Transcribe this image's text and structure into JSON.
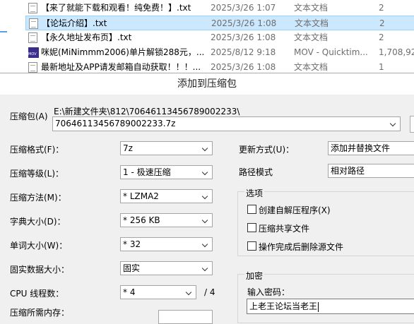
{
  "files": [
    {
      "name": "【来了就能下载和观看！纯免费！】.txt",
      "date": "2025/3/26 1:07",
      "type": "文本文档",
      "size": "2",
      "icon": "txt-file-icon",
      "selected": false
    },
    {
      "name": "【论坛介绍】.txt",
      "date": "2025/3/26 1:08",
      "type": "文本文档",
      "size": "2",
      "icon": "txt-file-icon",
      "selected": true
    },
    {
      "name": "【永久地址发布页】.txt",
      "date": "2025/3/26 1:08",
      "type": "文本文档",
      "size": "2",
      "icon": "txt-file-icon",
      "selected": false
    },
    {
      "name": "咪妮(MiNimmm2006)单片解锁288元，...",
      "date": "2025/8/12 9:18",
      "type": "MOV - Quicktim...",
      "size": "1,708,92",
      "icon": "mov-file-icon",
      "selected": false
    },
    {
      "name": "最新地址及APP请发邮箱自动获取！！！...",
      "date": "2025/3/26 1:08",
      "type": "文本文档",
      "size": "1",
      "icon": "txt-file-icon",
      "selected": false
    }
  ],
  "dialog": {
    "title": "添加到压缩包",
    "archive_label": "压缩包(A)",
    "archive_path": "E:\\新建文件夹\\812\\70646113456789002233\\",
    "archive_name": "70646113456789002233.7z",
    "format_label": "压缩格式(F)：",
    "format_value": "7z",
    "level_label": "压缩等级(L)：",
    "level_value": "1 - 极速压缩",
    "method_label": "压缩方法(M)：",
    "method_value": "* LZMA2",
    "dict_label": "字典大小(D)：",
    "dict_value": "* 256 KB",
    "word_label": "单词大小(W)：",
    "word_value": "* 32",
    "solid_label": "固实数据大小：",
    "solid_value": "固实",
    "threads_label": "CPU 线程数：",
    "threads_value": "* 4",
    "threads_total": "/ 4",
    "memory_label": "压缩所需内存：",
    "update_label": "更新方式(U)：",
    "update_value": "添加并替换文件",
    "path_label": "路径模式",
    "path_value": "相对路径",
    "options_title": "选项",
    "opt_sfx": "创建自解压程序(X)",
    "opt_shared": "压缩共享文件",
    "opt_delete": "操作完成后删除源文件",
    "encrypt_title": "加密",
    "password_label": "输入密码：",
    "password_value": "上老王论坛当老王"
  }
}
